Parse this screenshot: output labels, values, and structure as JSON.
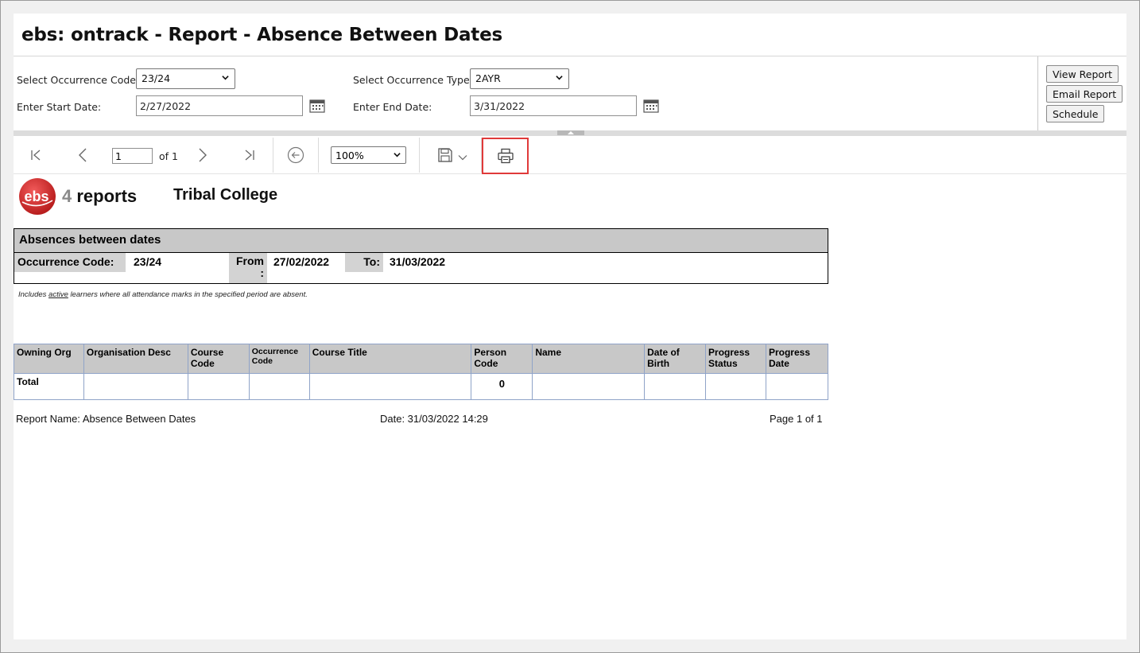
{
  "window": {
    "title": "ebs: ontrack - Report - Absence Between Dates"
  },
  "params": {
    "occ_code_label": "Select Occurrence Code:",
    "occ_code_value": "23/24",
    "occ_type_label": "Select Occurrence Type:",
    "occ_type_value": "2AYR",
    "start_label": "Enter Start Date:",
    "start_value": "2/27/2022",
    "end_label": "Enter End Date:",
    "end_value": "3/31/2022"
  },
  "actions": {
    "view": "View Report",
    "email": "Email Report",
    "schedule": "Schedule"
  },
  "toolbar": {
    "page_value": "1",
    "page_of": "of 1",
    "zoom": "100%"
  },
  "report": {
    "logo_ebs": "ebs",
    "logo_four": "4",
    "logo_reports": "reports",
    "college": "Tribal College",
    "section_title": "Absences between dates",
    "occ_label": "Occurrence Code:",
    "occ_value": "23/24",
    "from_label": "From :",
    "from_value": "27/02/2022",
    "to_label": "To:",
    "to_value": "31/03/2022",
    "note_pre": "Includes ",
    "note_active": "active",
    "note_post": " learners where all attendance marks in the specified period are absent.",
    "columns": [
      "Owning Org",
      "Organisation Desc",
      "Course Code",
      "Occurrence Code",
      "Course Title",
      "Person Code",
      "Name",
      "Date of Birth",
      "Progress Status",
      "Progress Date"
    ],
    "total_label": "Total",
    "total_person_code": "0",
    "footer_name": "Report Name: Absence Between Dates",
    "footer_date": "Date: 31/03/2022 14:29",
    "footer_page": "Page 1 of 1"
  },
  "colors": {
    "highlight": "#e03a3a",
    "header_grey": "#c8c8c8",
    "grid_border": "#8fa3c8",
    "logo_red": "#d92b2b"
  },
  "icons": [
    "chevron-down-icon",
    "calendar-icon",
    "first-page-icon",
    "previous-page-icon",
    "next-page-icon",
    "last-page-icon",
    "back-icon",
    "save-icon",
    "print-icon"
  ]
}
